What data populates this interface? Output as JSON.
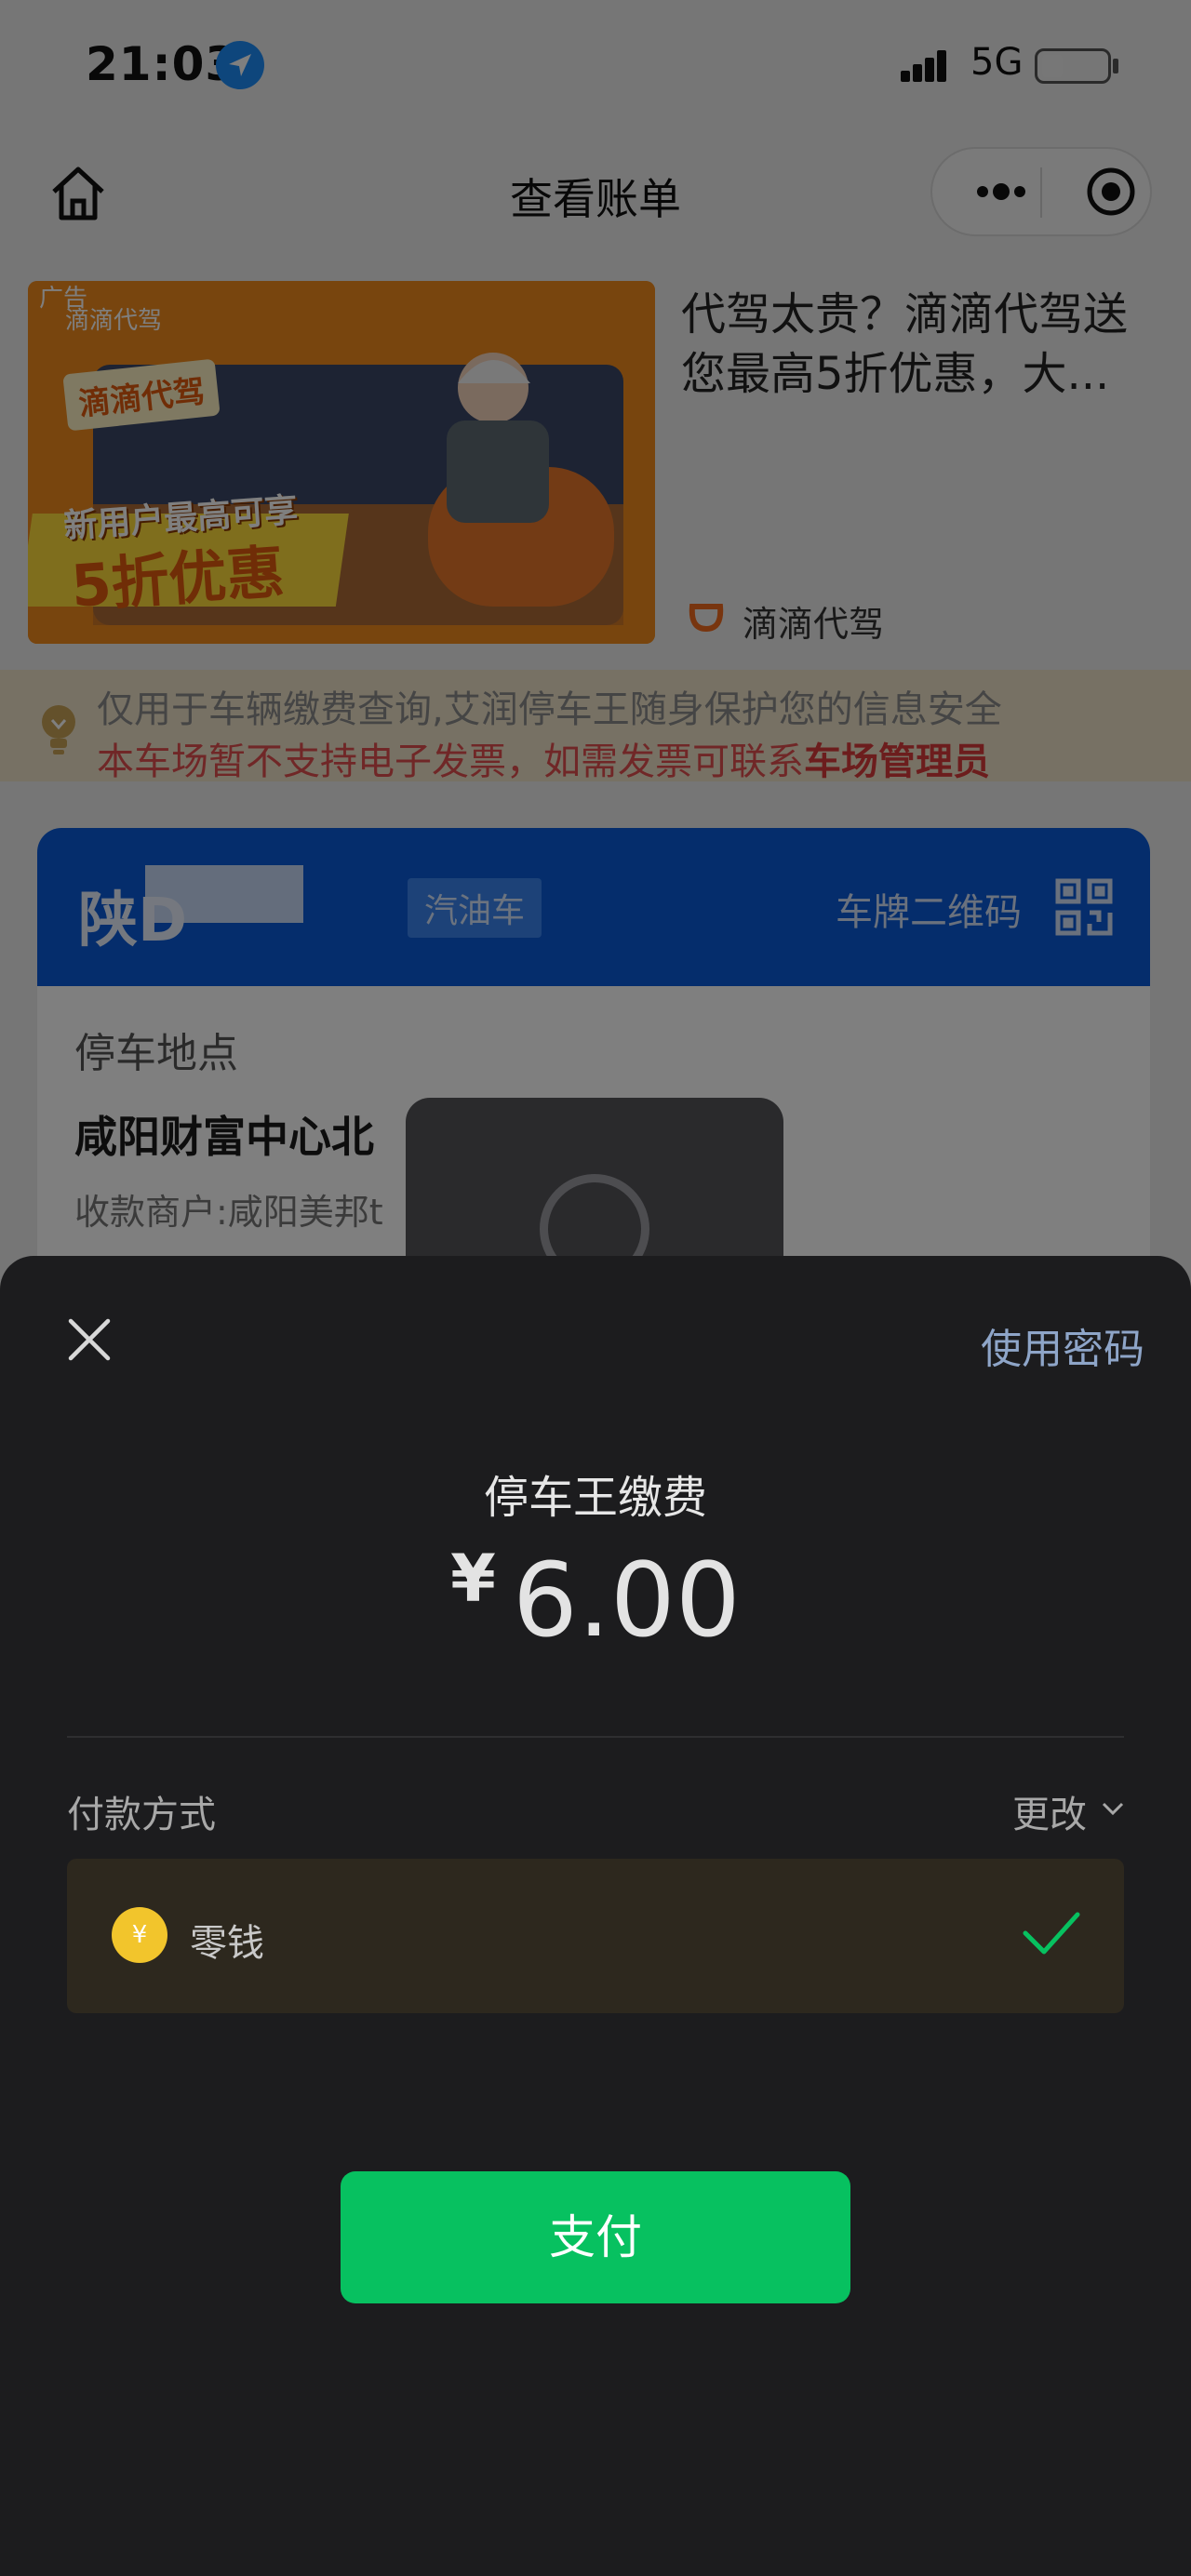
{
  "status_bar": {
    "time": "21:03",
    "network": "5G"
  },
  "nav": {
    "title": "查看账单"
  },
  "ad": {
    "tag": "广告",
    "title": "代驾太贵？滴滴代驾送您最高5折优惠，大...",
    "brand": "滴滴代驾",
    "image": {
      "logo": "滴滴代驾",
      "badge": "滴滴代驾",
      "line1": "新用户最高可享",
      "line2": "5折优惠"
    }
  },
  "notice": {
    "line1": "仅用于车辆缴费查询,艾润停车王随身保护您的信息安全",
    "line2_prefix": "本车场暂不支持电子发票，如需发票可联系",
    "line2_bold": "车场管理员"
  },
  "car_card": {
    "plate": "陕D",
    "fuel_type": "汽油车",
    "qr_label": "车牌二维码",
    "location_label": "停车地点",
    "location_name": "咸阳财富中心北",
    "merchant": "收款商户:咸阳美邦t"
  },
  "payment": {
    "use_password": "使用密码",
    "payee": "停车王缴费",
    "currency": "¥",
    "amount": "6.00",
    "method_label": "付款方式",
    "change": "更改",
    "method_name": "零钱",
    "coin_glyph": "¥",
    "pay_button": "支付"
  },
  "colors": {
    "pay_green": "#07c160",
    "plate_blue": "#0b5bd8",
    "notice_red": "#e04f4f",
    "sheet_bg": "#1c1c1e"
  }
}
